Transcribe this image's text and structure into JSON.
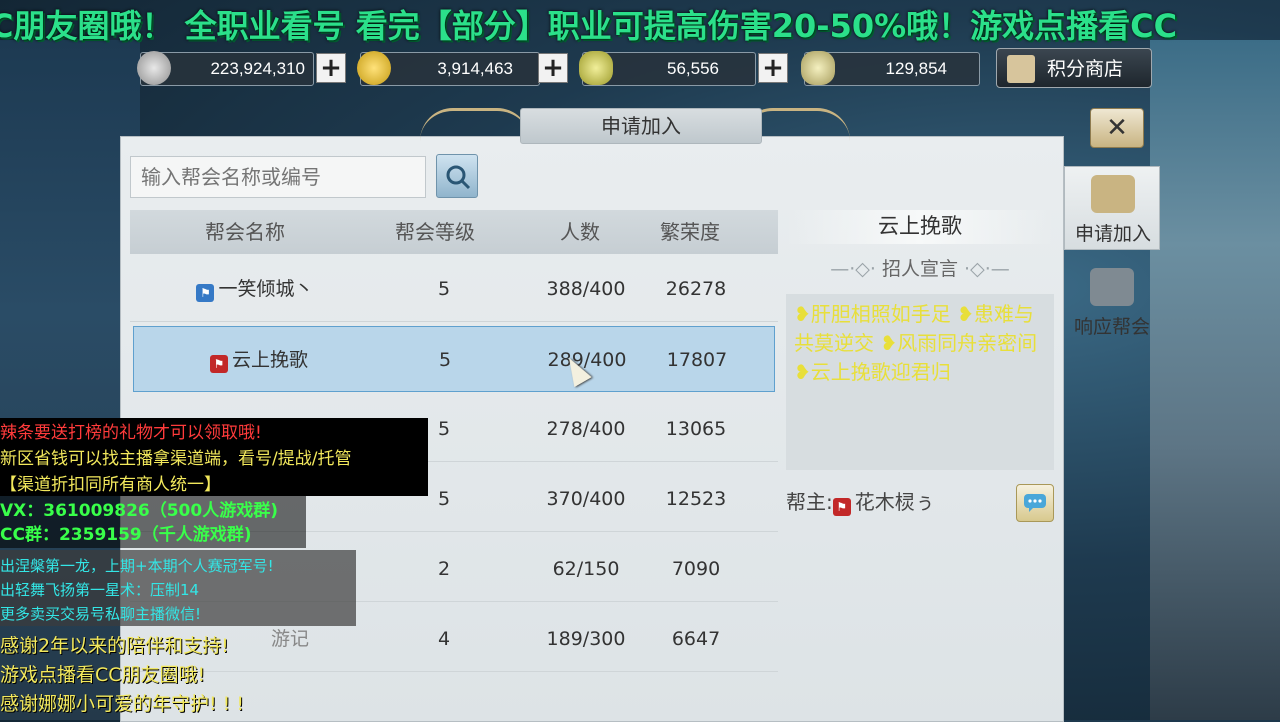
{
  "ticker": {
    "text": "C朋友圈哦！   全职业看号 看完【部分】职业可提高伤害20-50%哦！游戏点播看CC"
  },
  "currency": {
    "silver": "223,924,310",
    "gold": "3,914,463",
    "ingot": "56,556",
    "bound_ingot": "129,854",
    "plus": "+"
  },
  "shop": {
    "label": "积分商店"
  },
  "dialog": {
    "title": "申请加入",
    "close": "✕"
  },
  "search": {
    "placeholder": "输入帮会名称或编号"
  },
  "table": {
    "headers": [
      "帮会名称",
      "帮会等级",
      "人数",
      "繁荣度"
    ],
    "rows": [
      {
        "name": "一笑倾城丶",
        "level": "5",
        "members": "388/400",
        "prosperity": "26278",
        "badge": "blue"
      },
      {
        "name": "云上挽歌",
        "level": "5",
        "members": "289/400",
        "prosperity": "17807",
        "badge": "red",
        "selected": true
      },
      {
        "name": "",
        "level": "5",
        "members": "278/400",
        "prosperity": "13065"
      },
      {
        "name": "",
        "level": "5",
        "members": "370/400",
        "prosperity": "12523"
      },
      {
        "name": "",
        "level": "2",
        "members": "62/150",
        "prosperity": "7090"
      },
      {
        "name": "游记",
        "level": "4",
        "members": "189/300",
        "prosperity": "6647"
      }
    ]
  },
  "detail": {
    "guild_name": "云上挽歌",
    "recruit_label": "招人宣言",
    "declaration": "❥肝胆相照如手足 ❥患难与共莫逆交 ❥风雨同舟亲密间 ❥云上挽歌迎君归",
    "leader_label": "帮主:",
    "leader_name": "花木棂ぅ"
  },
  "tabs": [
    {
      "label": "申请加入",
      "active": true
    },
    {
      "label": "响应帮会",
      "active": false
    }
  ],
  "overlay": {
    "line1": "辣条要送打榜的礼物才可以领取哦!",
    "line2": "新区省钱可以找主播拿渠道端，看号/提战/托管",
    "line3": "【渠道折扣同所有商人统一】",
    "line4": "VX：361009826（500人游戏群)",
    "line5": "CC群：2359159（千人游戏群)",
    "line6": "出涅槃第一龙，上期+本期个人赛冠军号!",
    "line7": "出轻舞飞扬第一星术：压制14",
    "line8": "更多卖买交易号私聊主播微信!",
    "line9": "感谢2年以来的陪伴和支持!",
    "line10": "游戏点播看CC朋友圈哦!",
    "line11": "感谢娜娜小可爱的年守护! ! !"
  },
  "colors": {
    "ticker": "#2be08a",
    "overlay_red": "#ff3b3b",
    "overlay_yellow": "#f2e85c",
    "overlay_green": "#39ff4a",
    "overlay_cyan": "#33e6e6",
    "declaration": "#e8df3a",
    "selected_row": "#b9d6ea"
  }
}
